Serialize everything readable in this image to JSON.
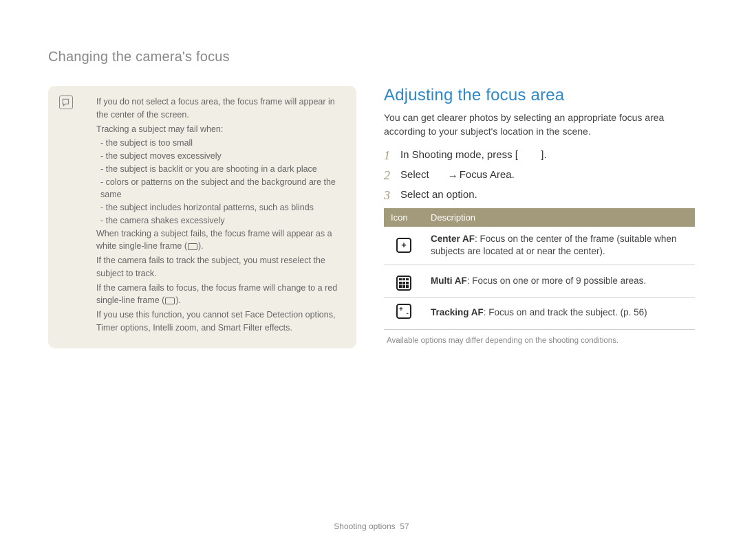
{
  "breadcrumb": "Changing the camera's focus",
  "note": {
    "intro": "If you do not select a focus area, the focus frame will appear in the center of the screen.",
    "fail_intro": "Tracking a subject may fail when:",
    "fail_items": [
      "the subject is too small",
      "the subject moves excessively",
      "the subject is backlit or you are shooting in a dark place",
      "colors or patterns on the subject and the background are the same",
      "the subject includes horizontal patterns, such as blinds",
      "the camera shakes excessively"
    ],
    "fail_result_pre": "When tracking a subject fails, the focus frame will appear as a white single-line frame (",
    "fail_result_post": ").",
    "reselect": "If the camera fails to track the subject, you must reselect the subject to track.",
    "red_pre": "If the camera fails to focus, the focus frame will change to a red single-line frame (",
    "red_post": ").",
    "restrict": "If you use this function, you cannot set Face Detection options, Timer options, Intelli zoom, and Smart Filter effects."
  },
  "section": {
    "title": "Adjusting the focus area",
    "desc": "You can get clearer photos by selecting an appropriate focus area according to your subject's location in the scene."
  },
  "steps": {
    "s1_pre": "In Shooting mode, press [",
    "s1_post": "].",
    "s2_pre": "Select ",
    "s2_arrow": " → ",
    "s2_post": "Focus Area.",
    "s3": "Select an option."
  },
  "table": {
    "h_icon": "Icon",
    "h_desc": "Description",
    "rows": [
      {
        "name": "Center AF",
        "desc": ": Focus on the center of the frame (suitable when subjects are located at or near the center)."
      },
      {
        "name": "Multi AF",
        "desc": ": Focus on one or more of 9 possible areas."
      },
      {
        "name": "Tracking AF",
        "desc": ": Focus on and track the subject. (p. 56)"
      }
    ],
    "note": "Available options may differ depending on the shooting conditions."
  },
  "footer": {
    "section": "Shooting options",
    "page": "57"
  }
}
